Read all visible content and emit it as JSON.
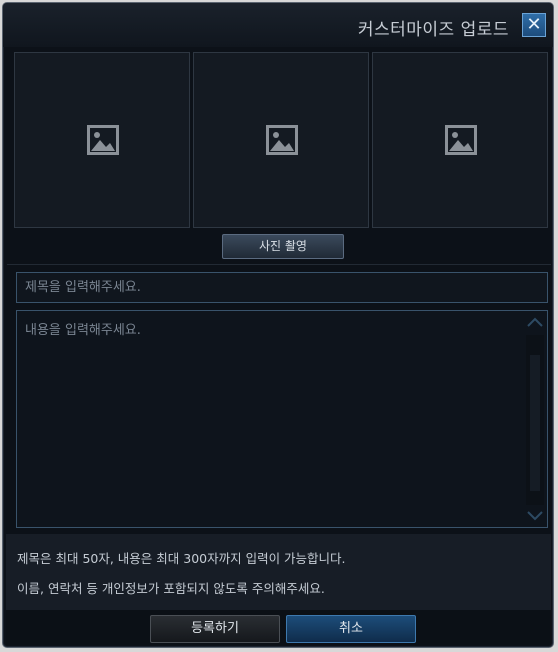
{
  "window": {
    "title": "커스터마이즈 업로드",
    "close_label": "✕"
  },
  "thumbnails": {
    "slots": [
      {
        "icon": "image-placeholder-icon"
      },
      {
        "icon": "image-placeholder-icon"
      },
      {
        "icon": "image-placeholder-icon"
      }
    ],
    "capture_button_label": "사진 촬영"
  },
  "form": {
    "title_placeholder": "제목을 입력해주세요.",
    "content_placeholder": "내용을 입력해주세요."
  },
  "notice": {
    "line1": "제목은 최대 50자, 내용은 최대 300자까지 입력이 가능합니다.",
    "line2": "이름, 연락처 등 개인정보가 포함되지 않도록 주의해주세요."
  },
  "footer": {
    "register_label": "등록하기",
    "cancel_label": "취소"
  },
  "colors": {
    "background": "#0c1118",
    "accent": "#2f6ea8",
    "input_border": "#39536b"
  }
}
